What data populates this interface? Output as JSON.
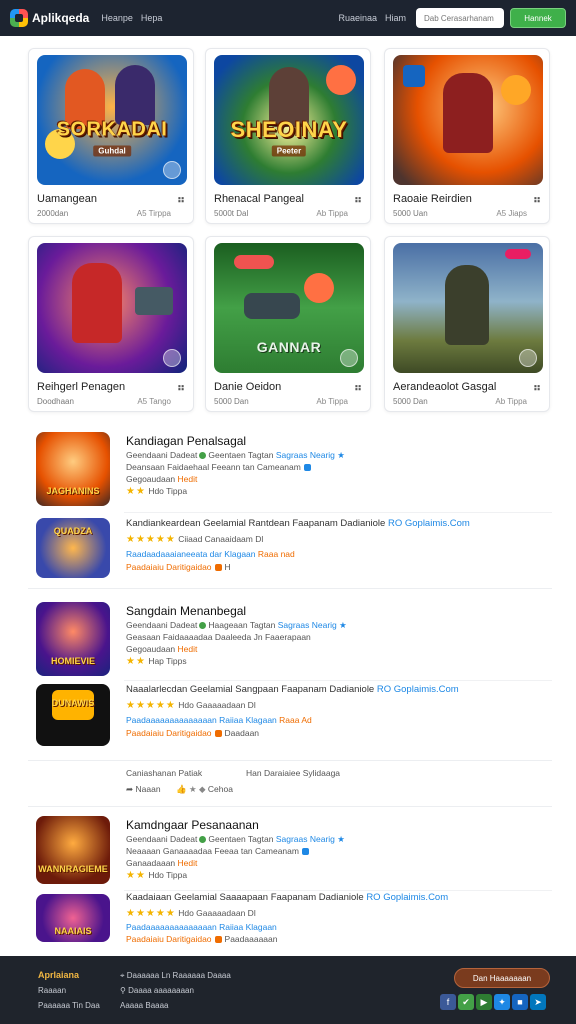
{
  "header": {
    "app_name": "Aplikqeda",
    "nav": [
      "Heanpe",
      "Hepa"
    ],
    "nav_right": [
      "Ruaeinaa",
      "Hiam"
    ],
    "search_placeholder": "Dab Cerasarhanam",
    "cta_label": "Hannek"
  },
  "grid": [
    {
      "art_title": "SORKADAI",
      "art_sub": "Guhdal",
      "title": "Uamangean",
      "sub": "2000dan",
      "downloads": "A5 Tirppa"
    },
    {
      "art_title": "SHEOINAY",
      "art_sub": "Peeter",
      "title": "Rhenacal Pangeal",
      "sub": "5000t Dal",
      "downloads": "Ab Tippa"
    },
    {
      "art_title": "",
      "art_sub": "",
      "title": "Raoaie Reirdien",
      "sub": "5000 Uan",
      "downloads": "A5 Jiaps"
    },
    {
      "art_title": "",
      "art_sub": "",
      "title": "Reihgerl Penagen",
      "sub": "Doodhaan",
      "downloads": "A5 Tango"
    },
    {
      "art_title": "GANNAR",
      "art_sub": "",
      "title": "Danie Oeidon",
      "sub": "5000 Dan",
      "downloads": "Ab Tippa"
    },
    {
      "art_title": "",
      "art_sub": "",
      "title": "Aerandeaolot Gasgal",
      "sub": "5000 Dan",
      "downloads": "Ab Tippa"
    }
  ],
  "list": [
    {
      "thumb_label": "JAGHANINS",
      "title": "Kandiagan Penalsagal",
      "line1": "Geendaani Dadeat",
      "line1b": "Geentaen Tagtan",
      "line1c": "Sagraas Nearig",
      "line2": "Deansaan Faidaehaal Feeann tan Cameanam",
      "line3": "Gegoaudaan",
      "line3b": "Hedit",
      "rating": "★★",
      "rating_text": "Hdo Tippa"
    },
    {
      "thumb_label": "QUADZA",
      "title": "Kandiankeardean Geelamial Rantdean Faapanam Dadianiole",
      "title_link": "RO Goplaimis.Com",
      "rating": "★★★★★",
      "rating_text": "Ciiaad Canaaidaam Dl",
      "line2": "Raadaadaaaianeeata dar Klagaan",
      "line2b": "Raaa nad",
      "line3": "Paadaiaiu Daritigaidao",
      "line3b": "H"
    },
    {
      "thumb_label": "HOMIEVIE",
      "title": "Sangdain Menanbegal",
      "line1": "Geendaani Dadeat",
      "line1b": "Haageaan Tagtan",
      "line1c": "Sagraas Nearig",
      "line2": "Geasaan Faidaaaadaa Daaleeda Jn Faaerapaan",
      "line3": "Gegoaudaan",
      "line3b": "Hedit",
      "rating": "★★",
      "rating_text": "Hap Tipps"
    },
    {
      "thumb_label": "DUNAWIS",
      "title": "Naaalarlecdan Geelamial Sangpaan Faapanam Dadianiole",
      "title_link": "RO Goplaimis.Com",
      "rating": "★★★★★",
      "rating_text": "Hdo Gaaaaadaan Dl",
      "line2": "Paadaaaaaaaaaaaaaan Raiiaa Klagaan",
      "line2b": "Raaa Ad",
      "line3": "Paadaiaiu Daritigaidao",
      "line3b": "Daadaan"
    }
  ],
  "mid": {
    "left": "Caniashanan Patiak",
    "right": "Han Daraiaiee Sylidaaga",
    "left2": "Naaan",
    "right2": "Cehoa"
  },
  "list2": [
    {
      "thumb_label": "WANNRAGIEME",
      "title": "Kamdngaar Pesanaanan",
      "line1": "Geendaani Dadeat",
      "line1b": "Geentaen Tagtan",
      "line1c": "Sagraas Nearig",
      "line2": "Neaaaan Ganaaaadaa Feeaa tan Cameanam",
      "line3": "Ganaadaaan",
      "line3b": "Hedit",
      "rating": "★★",
      "rating_text": "Hdo Tippa"
    },
    {
      "thumb_label": "NAAIAIS",
      "title": "Kaadaiaan Geelamial Saaaapaan Faapanam Dadianiole",
      "title_link": "RO Goplaimis.Com",
      "rating": "★★★★★",
      "rating_text": "Hdo Gaaaaadaan Dl",
      "line2": "Paadaaaaaaaaaaaaaan Raiiaa Klagaan",
      "line3": "Paadaiaiu Daritigaidao",
      "line3b": "Paadaaaaaan"
    }
  ],
  "footer": {
    "head": "Aprlaiana",
    "col1": [
      "Raaaan",
      "Paaaaaa Tin Daa"
    ],
    "col2": [
      "Daaaaaa Ln Raaaaaa Daaaa",
      "Daaaa aaaaaaaan",
      "Aaaaa Baaaa"
    ],
    "button": "Dan Haaaaaaan"
  },
  "colors": {
    "accent": "#3fb04a",
    "header_bg": "#1d2430",
    "link": "#1e88e5",
    "star": "#f4b400"
  }
}
